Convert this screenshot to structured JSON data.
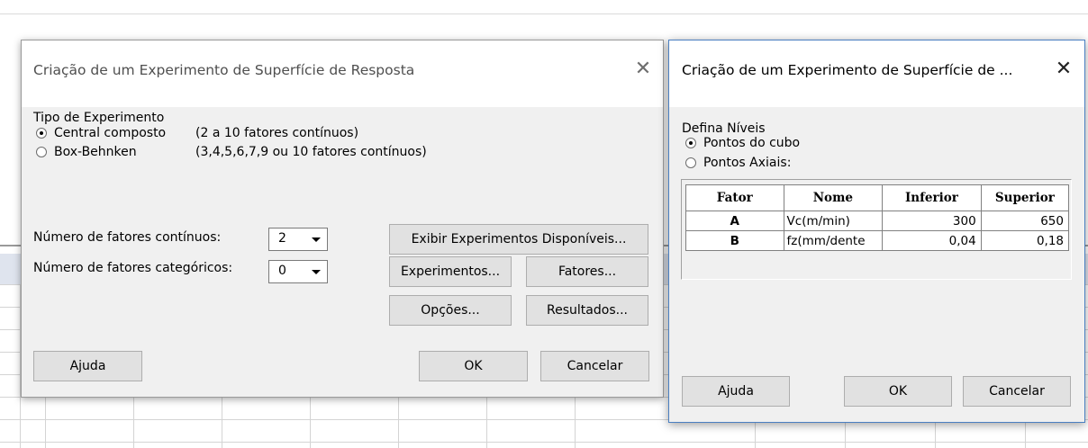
{
  "dialog1": {
    "title": "Criação de um Experimento de Superfície de Resposta",
    "type_label": "Tipo de Experimento",
    "options": [
      {
        "label": "Central composto",
        "desc": "(2 a 10 fatores contínuos)",
        "checked": true
      },
      {
        "label": "Box-Behnken",
        "desc": "(3,4,5,6,7,9 ou 10 fatores contínuos)",
        "checked": false
      }
    ],
    "continuous_label": "Número de fatores contínuos:",
    "continuous_value": "2",
    "categorical_label": "Número de fatores categóricos:",
    "categorical_value": "0",
    "buttons": {
      "show_designs": "Exibir Experimentos Disponíveis...",
      "designs": "Experimentos...",
      "factors": "Fatores...",
      "options": "Opções...",
      "results": "Resultados...",
      "help": "Ajuda",
      "ok": "OK",
      "cancel": "Cancelar"
    }
  },
  "dialog2": {
    "title": "Criação de um Experimento de Superfície de ...",
    "levels_label": "Defina Níveis",
    "options": [
      {
        "label": "Pontos do cubo",
        "checked": true
      },
      {
        "label": "Pontos Axiais:",
        "checked": false
      }
    ],
    "table": {
      "headers": [
        "Fator",
        "Nome",
        "Inferior",
        "Superior"
      ],
      "rows": [
        [
          "A",
          "Vc(m/min)",
          "300",
          "650"
        ],
        [
          "B",
          "fz(mm/dente",
          "0,04",
          "0,18"
        ]
      ]
    },
    "buttons": {
      "help": "Ajuda",
      "ok": "OK",
      "cancel": "Cancelar"
    }
  }
}
